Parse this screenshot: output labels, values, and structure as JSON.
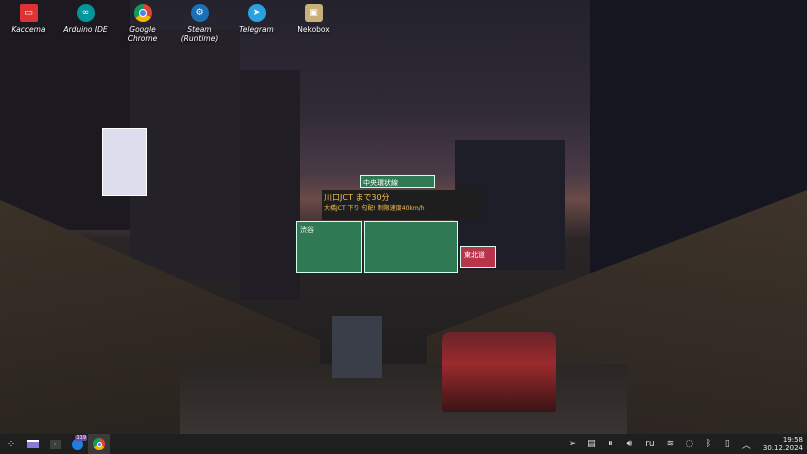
{
  "desktop_icons": [
    {
      "label": "Kaccema",
      "icon": "cassette-icon",
      "color": "#d33"
    },
    {
      "label": "Arduino IDE",
      "icon": "arduino-icon",
      "color": "#00979c"
    },
    {
      "label": "Google Chrome",
      "icon": "chrome-icon",
      "color": "#4285f4"
    },
    {
      "label": "Steam (Runtime)",
      "icon": "steam-icon",
      "color": "#1a6fb5"
    },
    {
      "label": "Telegram",
      "icon": "telegram-icon",
      "color": "#2aa1e0"
    },
    {
      "label": "Nekobox",
      "icon": "nekobox-icon",
      "color": "#c9b07a"
    }
  ],
  "taskbar": {
    "apps": [
      {
        "name": "app-launcher"
      },
      {
        "name": "file-manager"
      },
      {
        "name": "terminal"
      },
      {
        "name": "thunderbird",
        "badge": "119"
      },
      {
        "name": "google-chrome"
      }
    ],
    "tray": {
      "language": "ru",
      "time": "19:58",
      "date": "30.12.2024"
    }
  },
  "wallpaper": {
    "sign_text": [
      "川口JCT まで30分",
      "大橋JCT 下り 匂配! 制限速度40km/h",
      "中央環状線",
      "渋谷",
      "東北道"
    ]
  }
}
